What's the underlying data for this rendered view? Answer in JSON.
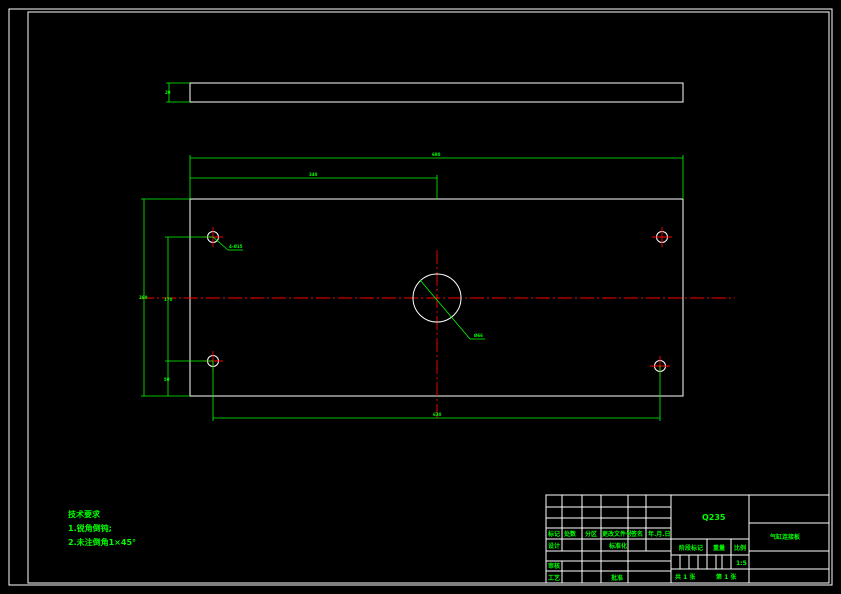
{
  "dimensions": {
    "overall_width": "680",
    "center_offset": "340",
    "height": "280",
    "hole_spacing_v": "170",
    "hole_offset_v": "50",
    "hole_spacing_h": "630",
    "thickness": "20",
    "small_holes": "4-Ø15",
    "center_hole": "Ø66"
  },
  "notes": {
    "title": "技术要求",
    "line1": "1.锐角倒钝;",
    "line2": "2.未注倒角1×45°"
  },
  "title_block": {
    "material": "Q235",
    "part_name": "气缸连接板",
    "scale": "1:5",
    "sheet_total": "共 1 张",
    "sheet_num": "第 1 张",
    "h_mark": "标记",
    "h_qty": "处数",
    "h_zone": "分区",
    "h_change_doc": "更改文件号",
    "h_sign": "签名",
    "h_date": "年.月.日",
    "h_design": "设计",
    "h_standardize": "标准化",
    "h_stage_mark": "阶段标记",
    "h_weight": "重量",
    "h_scale": "比例",
    "h_review": "审核",
    "h_process": "工艺",
    "h_approve": "批准"
  },
  "colors": {
    "outline": "#ffffff",
    "dimension": "#00ff00",
    "centerline": "#ff0000",
    "background": "#000000"
  }
}
